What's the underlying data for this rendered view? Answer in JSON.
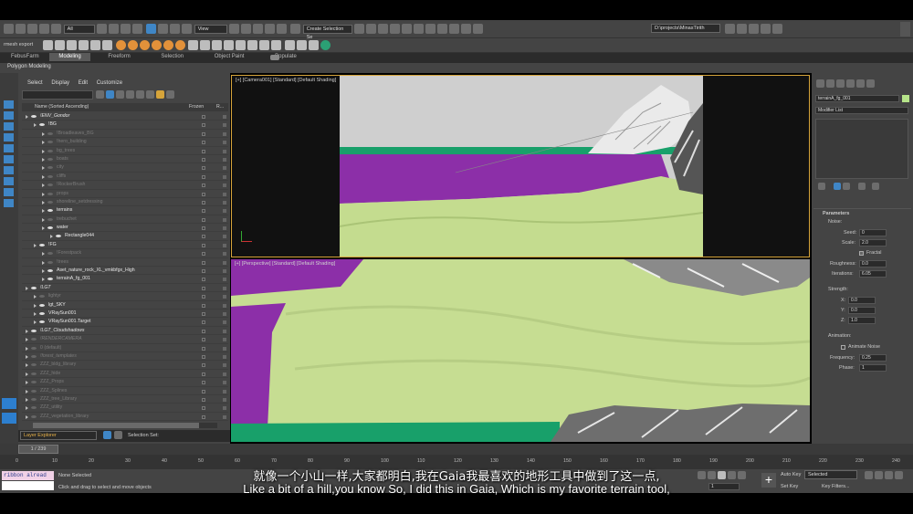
{
  "top_toolbar": {
    "workspace_dropdown": "All",
    "view_dropdown": "View",
    "selection_set": "Create Selection Se",
    "project_path": "D:\\projects\\MinasTirith",
    "left_label": "rmesh export"
  },
  "ribbon": {
    "tabs": [
      "FebusFarm",
      "Modeling",
      "Freeform",
      "Selection",
      "Object Paint",
      "Populate"
    ],
    "active": "Modeling",
    "sub_label": "Polygon Modeling"
  },
  "scene_explorer": {
    "menu": [
      "Select",
      "Display",
      "Edit",
      "Customize"
    ],
    "col_name": "Name (Sorted Ascending)",
    "col_frozen": "Frozen",
    "col_r": "R...",
    "rows": [
      {
        "label": "!ENV_Gondor",
        "indent": 0,
        "dim": false
      },
      {
        "label": "!BG",
        "indent": 1,
        "dim": false
      },
      {
        "label": "!Broadleaves_BG",
        "indent": 2,
        "dim": true
      },
      {
        "label": "!hero_building",
        "indent": 2,
        "dim": true
      },
      {
        "label": "bg_trees",
        "indent": 2,
        "dim": true
      },
      {
        "label": "boats",
        "indent": 2,
        "dim": true
      },
      {
        "label": "city",
        "indent": 2,
        "dim": true
      },
      {
        "label": "cliffs",
        "indent": 2,
        "dim": true
      },
      {
        "label": "!RockerBrush",
        "indent": 2,
        "dim": true
      },
      {
        "label": "props",
        "indent": 2,
        "dim": true
      },
      {
        "label": "shoreline_setdressing",
        "indent": 2,
        "dim": true
      },
      {
        "label": "terrains",
        "indent": 2,
        "dim": false
      },
      {
        "label": "trebuchet",
        "indent": 2,
        "dim": true
      },
      {
        "label": "water",
        "indent": 2,
        "dim": false
      },
      {
        "label": "Rectangle044",
        "indent": 3,
        "dim": false
      },
      {
        "label": "!FG",
        "indent": 1,
        "dim": false
      },
      {
        "label": "!Forestpack",
        "indent": 2,
        "dim": true
      },
      {
        "label": "!trees",
        "indent": 2,
        "dim": true
      },
      {
        "label": "Aset_nature_rock_XL_vmkbfgx_High",
        "indent": 2,
        "dim": false
      },
      {
        "label": "terrainA_fg_001",
        "indent": 2,
        "dim": false
      },
      {
        "label": "!LGT",
        "indent": 0,
        "dim": false
      },
      {
        "label": "lightyr",
        "indent": 1,
        "dim": true
      },
      {
        "label": "lgt_SKY",
        "indent": 1,
        "dim": false
      },
      {
        "label": "VRaySun001",
        "indent": 1,
        "dim": false
      },
      {
        "label": "VRaySun001.Target",
        "indent": 1,
        "dim": false
      },
      {
        "label": "!LGT_Cloudshadows",
        "indent": 0,
        "dim": false
      },
      {
        "label": "!RENDERCAMERA",
        "indent": 0,
        "dim": true
      },
      {
        "label": "0 (default)",
        "indent": 0,
        "dim": true
      },
      {
        "label": "!forest_templates",
        "indent": 0,
        "dim": true
      },
      {
        "label": "ZZZ_bldg_library",
        "indent": 0,
        "dim": true
      },
      {
        "label": "ZZZ_hide",
        "indent": 0,
        "dim": true
      },
      {
        "label": "ZZZ_Props",
        "indent": 0,
        "dim": true
      },
      {
        "label": "ZZZ_Splines",
        "indent": 0,
        "dim": true
      },
      {
        "label": "ZZZ_tree_Library",
        "indent": 0,
        "dim": true
      },
      {
        "label": "ZZZ_utility",
        "indent": 0,
        "dim": true
      },
      {
        "label": "ZZZ_vegetation_library",
        "indent": 0,
        "dim": true
      }
    ],
    "footer_dropdown": "Layer Explorer",
    "selection_set_label": "Selection Set:"
  },
  "viewports": {
    "top_label": "[+] [Camera001] [Standard] [Default Shading]",
    "bottom_label": "[+] [Perspective] [Standard] [Default Shading]"
  },
  "command_panel": {
    "object_name": "terrainA_fg_001",
    "modifier_list": "Modifier List",
    "params_title": "Parameters",
    "noise_label": "Noise:",
    "seed_label": "Seed:",
    "seed": "0",
    "scale_label": "Scale:",
    "scale": "2.0",
    "fractal_label": "Fractal",
    "roughness_label": "Roughness:",
    "roughness": "0.0",
    "iterations_label": "Iterations:",
    "iterations": "6.05",
    "strength_label": "Strength:",
    "x_label": "X:",
    "x": "0.0",
    "y_label": "Y:",
    "y": "0.0",
    "z_label": "Z:",
    "z": "1.0",
    "animation_label": "Animation:",
    "animate_label": "Animate Noise",
    "freq_label": "Frequency:",
    "freq": "0.25",
    "phase_label": "Phase:",
    "phase": "1"
  },
  "timeline": {
    "frame_counter": "1 / 239",
    "ticks": [
      "0",
      "10",
      "20",
      "30",
      "40",
      "50",
      "60",
      "70",
      "80",
      "90",
      "100",
      "110",
      "120",
      "130",
      "140",
      "150",
      "160",
      "170",
      "180",
      "190",
      "200",
      "210",
      "220",
      "230",
      "240"
    ]
  },
  "status": {
    "maxscript": "ribbon alread",
    "selected": "None Selected",
    "hint": "Click and drag to select and move objects",
    "auto_key": "Auto Key",
    "set_key": "Set Key",
    "selected_dd": "Selected",
    "key_filters": "Key Filters...",
    "frame": "1"
  },
  "subtitles": {
    "chinese": "就像一个小山一样,大家都明白,我在Gaia我最喜欢的地形工具中做到了这一点,",
    "english": "Like a bit of a hill,you know So, I did this in Gaia, Which is my favorite terrain tool,"
  }
}
